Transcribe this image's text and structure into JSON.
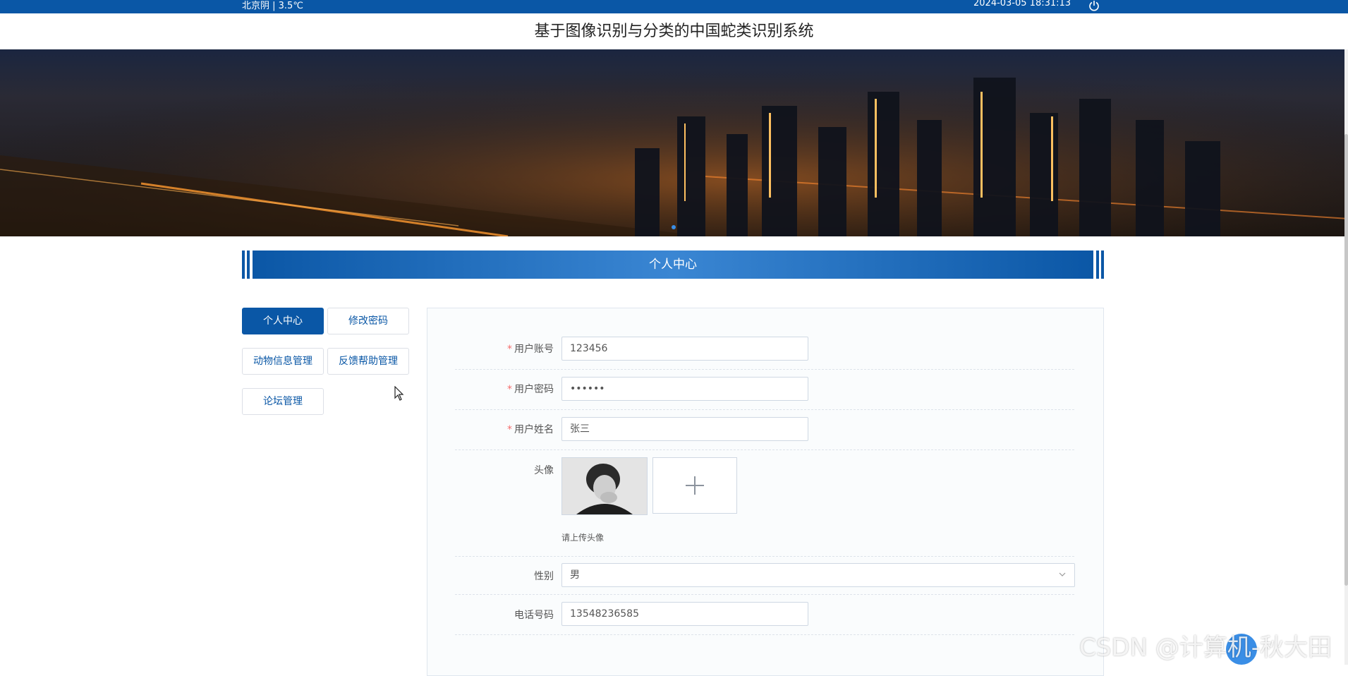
{
  "topbar": {
    "weather": "北京阴 | 3.5℃",
    "datetime": "2024-03-05   18:31:13",
    "power_icon": "power-icon"
  },
  "header": {
    "title": "基于图像识别与分类的中国蛇类识别系统"
  },
  "section": {
    "title": "个人中心"
  },
  "menu": {
    "items": [
      "个人中心",
      "修改密码",
      "动物信息管理",
      "反馈帮助管理",
      "论坛管理"
    ],
    "active_index": 0
  },
  "form": {
    "account": {
      "label": "用户账号",
      "value": "123456",
      "required": true
    },
    "password": {
      "label": "用户密码",
      "value": "••••••",
      "required": true
    },
    "name": {
      "label": "用户姓名",
      "value": "张三",
      "required": true
    },
    "avatar": {
      "label": "头像",
      "hint": "请上传头像"
    },
    "gender": {
      "label": "性别",
      "value": "男"
    },
    "phone": {
      "label": "电话号码",
      "value": "13548236585"
    }
  },
  "watermark": "CSDN @计算机-秋大田",
  "colors": {
    "primary": "#0a57a6",
    "required": "#f56c6c"
  }
}
